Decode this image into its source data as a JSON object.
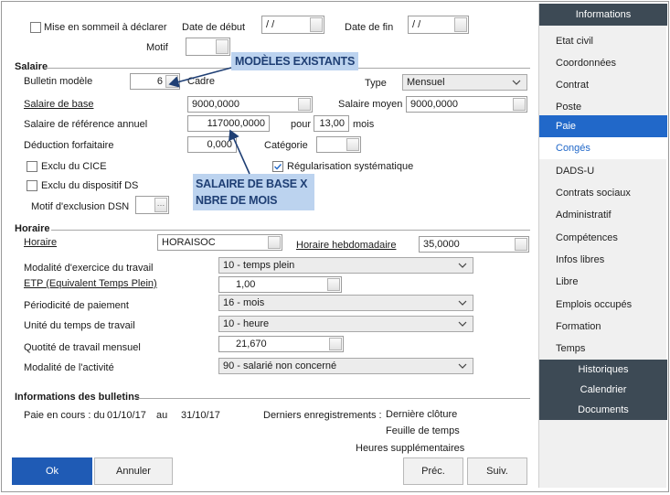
{
  "top": {
    "sleep_label": "Mise en sommeil à déclarer",
    "start_label": "Date de début",
    "start_value": "/ /",
    "end_label": "Date de fin",
    "end_value": "/ /",
    "motif_label": "Motif",
    "motif_value": ""
  },
  "salaire": {
    "section": "Salaire",
    "bulletin_label": "Bulletin modèle",
    "bulletin_value": "6",
    "cadre_label": "Cadre",
    "type_label": "Type",
    "type_value": "Mensuel",
    "base_label": "Salaire de base",
    "base_value": "9000,0000",
    "moyen_label": "Salaire moyen",
    "moyen_value": "9000,0000",
    "ref_label": "Salaire de référence annuel",
    "ref_value": "117000,0000",
    "pour_label": "pour",
    "months_value": "13,00",
    "mois_label": "mois",
    "deduction_label": "Déduction forfaitaire",
    "deduction_value": "0,000",
    "categorie_label": "Catégorie",
    "categorie_value": "",
    "cice_label": "Exclu du CICE",
    "regul_label": "Régularisation systématique",
    "ds_label": "Exclu du dispositif DS",
    "dsn_label": "Motif d'exclusion DSN",
    "dsn_value": ""
  },
  "callouts": {
    "models": "MODÈLES EXISTANTS",
    "formula_line1": "SALAIRE DE BASE X",
    "formula_line2": "NBRE DE MOIS"
  },
  "horaire": {
    "section": "Horaire",
    "horaire_label": "Horaire",
    "horaire_value": "HORAISOC",
    "hebdo_label": "Horaire hebdomadaire",
    "hebdo_value": "35,0000",
    "modalite_label": "Modalité d'exercice du travail",
    "modalite_value": "10 - temps plein",
    "etp_label": "ETP (Equivalent Temps Plein)",
    "etp_value": "1,00",
    "periodicite_label": "Périodicité de paiement",
    "periodicite_value": "16 - mois",
    "unite_label": "Unité du temps de travail",
    "unite_value": "10 - heure",
    "quotite_label": "Quotité de travail mensuel",
    "quotite_value": "21,670",
    "activite_label": "Modalité de l'activité",
    "activite_value": "90 - salarié non concerné"
  },
  "bulletins": {
    "section": "Informations des bulletins",
    "paie_label": "Paie en cours : du",
    "from": "01/10/17",
    "au": "au",
    "to": "31/10/17",
    "derniers_label": "Derniers enregistrements :",
    "rec1": "Dernière clôture",
    "rec2": "Feuille de temps",
    "rec3": "Heures supplémentaires"
  },
  "buttons": {
    "ok": "Ok",
    "cancel": "Annuler",
    "prev": "Préc.",
    "next": "Suiv."
  },
  "sidebar": {
    "header": "Informations",
    "items": [
      "Etat civil",
      "Coordonnées",
      "Contrat",
      "Poste",
      "Paie",
      "Congés",
      "DADS-U",
      "Contrats sociaux",
      "Administratif",
      "Compétences",
      "Infos libres",
      "Libre",
      "Emplois occupés",
      "Formation",
      "Temps"
    ],
    "sub": [
      "Historiques",
      "Calendrier",
      "Documents"
    ]
  },
  "colors": {
    "accent": "#2168c9",
    "ok_button": "#1f5bb5",
    "sidebar_dark": "#3d4a55",
    "callout_bg": "#bcd3ef",
    "callout_text": "#1f3f74",
    "arrow": "#1f3f74"
  }
}
